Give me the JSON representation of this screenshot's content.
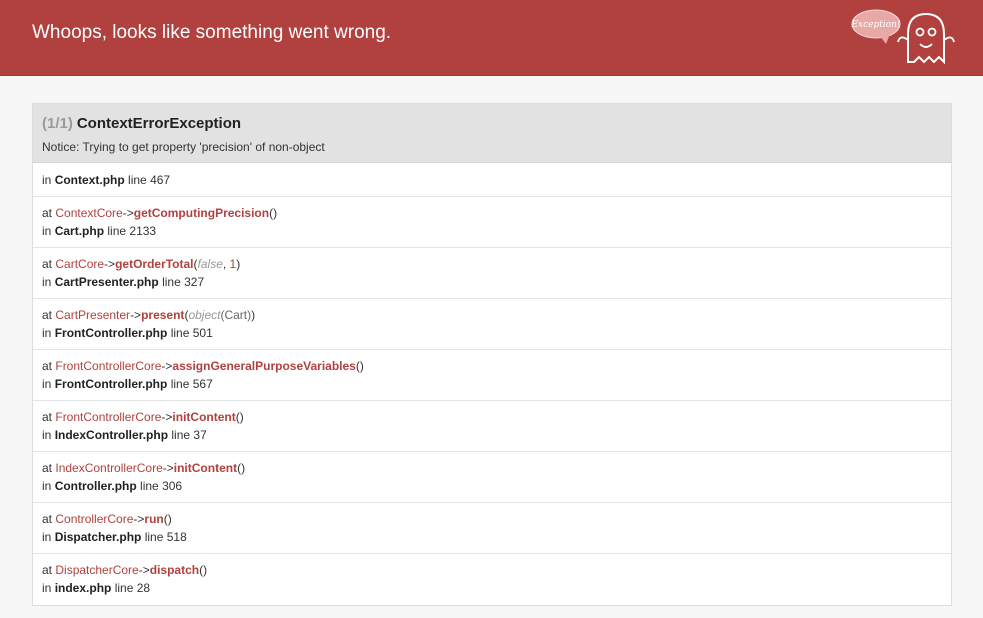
{
  "header": {
    "title": "Whoops, looks like something went wrong.",
    "badge_text": "Exception!"
  },
  "exception": {
    "count": "(1/1)",
    "name": "ContextErrorException",
    "message": "Notice: Trying to get property 'precision' of non-object",
    "origin": {
      "in": "in",
      "file": "Context.php",
      "line_label": "line",
      "line": "467"
    }
  },
  "trace": [
    {
      "at": "at",
      "class": "ContextCore",
      "arrow": "->",
      "method": "getComputingPrecision",
      "open": "(",
      "close": ")",
      "in": "in",
      "file": "Cart.php",
      "line_label": "line",
      "line": "2133"
    },
    {
      "at": "at",
      "class": "CartCore",
      "arrow": "->",
      "method": "getOrderTotal",
      "open": "(",
      "arg1": "false",
      "sep": ", ",
      "arg2": "1",
      "close": ")",
      "in": "in",
      "file": "CartPresenter.php",
      "line_label": "line",
      "line": "327"
    },
    {
      "at": "at",
      "class": "CartPresenter",
      "arrow": "->",
      "method": "present",
      "open": "(",
      "arg1": "object",
      "arg2": "(Cart)",
      "close": ")",
      "in": "in",
      "file": "FrontController.php",
      "line_label": "line",
      "line": "501"
    },
    {
      "at": "at",
      "class": "FrontControllerCore",
      "arrow": "->",
      "method": "assignGeneralPurposeVariables",
      "open": "(",
      "close": ")",
      "in": "in",
      "file": "FrontController.php",
      "line_label": "line",
      "line": "567"
    },
    {
      "at": "at",
      "class": "FrontControllerCore",
      "arrow": "->",
      "method": "initContent",
      "open": "(",
      "close": ")",
      "in": "in",
      "file": "IndexController.php",
      "line_label": "line",
      "line": "37"
    },
    {
      "at": "at",
      "class": "IndexControllerCore",
      "arrow": "->",
      "method": "initContent",
      "open": "(",
      "close": ")",
      "in": "in",
      "file": "Controller.php",
      "line_label": "line",
      "line": "306"
    },
    {
      "at": "at",
      "class": "ControllerCore",
      "arrow": "->",
      "method": "run",
      "open": "(",
      "close": ")",
      "in": "in",
      "file": "Dispatcher.php",
      "line_label": "line",
      "line": "518"
    },
    {
      "at": "at",
      "class": "DispatcherCore",
      "arrow": "->",
      "method": "dispatch",
      "open": "(",
      "close": ")",
      "in": "in",
      "file": "index.php",
      "line_label": "line",
      "line": "28"
    }
  ],
  "colors": {
    "header_bg": "#b0413e",
    "accent": "#b0413e",
    "panel_head_bg": "#e2e2e2",
    "page_bg": "#f7f7f7"
  },
  "icons": {
    "mascot": "ghost-mascot-icon"
  }
}
